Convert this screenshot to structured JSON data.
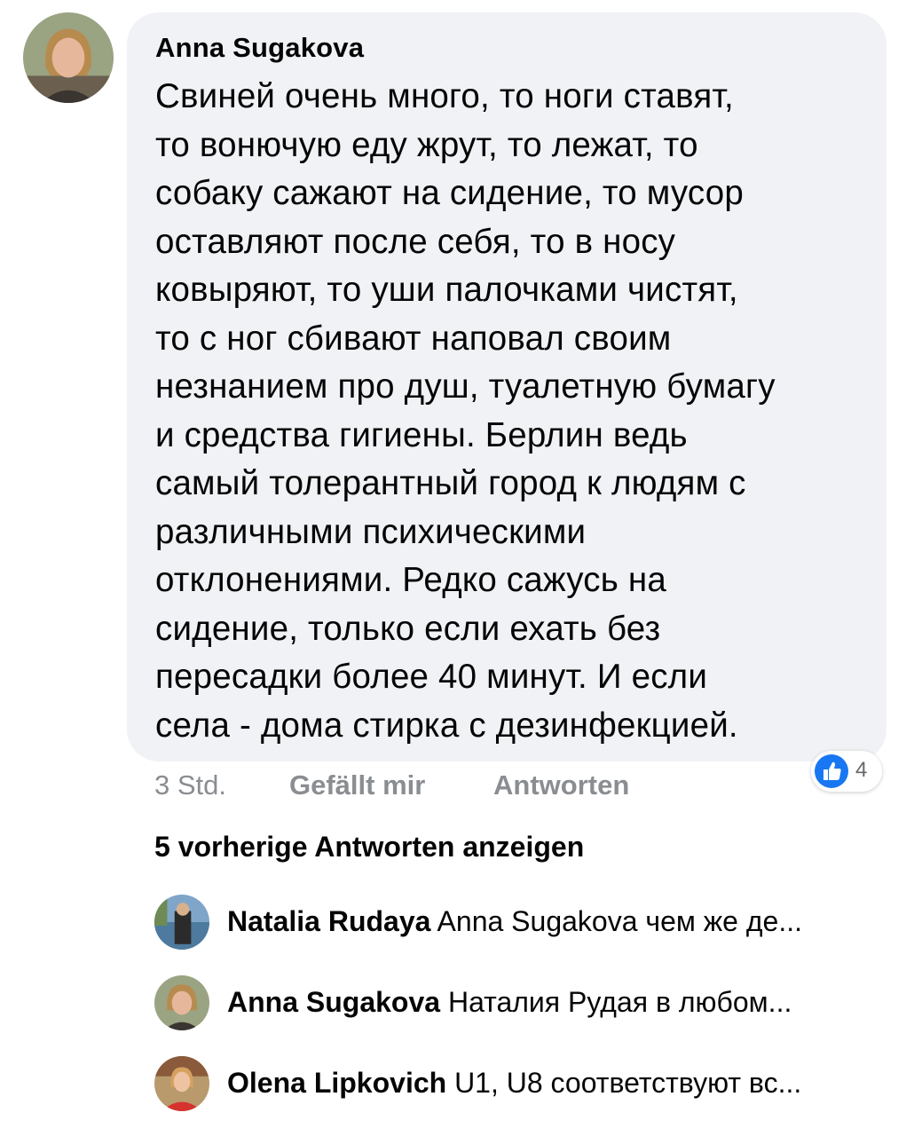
{
  "comment": {
    "author": "Anna Sugakova",
    "lines": [
      "Свиней очень много, то ноги ставят,",
      "то вонючую еду жрут, то лежат, то",
      "собаку сажают на сидение, то мусор",
      "оставляют после себя, то в носу",
      "ковыряют, то уши палочками чистят,",
      "то с ног сбивают наповал своим",
      "незнанием про душ, туалетную бумагу",
      "и средства гигиены. Берлин ведь",
      "самый толерантный город к людям с",
      "различными психическими",
      "отклонениями. Редко сажусь на",
      "сидение, только если ехать без",
      "пересадки более 40 минут. И если",
      "села - дома стирка с дезинфекцией."
    ],
    "time": "3 Std.",
    "like_label": "Gefällt mir",
    "reply_label": "Antworten",
    "reaction_icon": "like-icon",
    "reaction_count": "4"
  },
  "view_previous_label": "5 vorherige Antworten anzeigen",
  "replies": [
    {
      "name": "Natalia Rudaya",
      "text": "Anna Sugakova чем же де..."
    },
    {
      "name": "Anna Sugakova",
      "text": "Наталия Рудая в любом..."
    },
    {
      "name": "Olena Lipkovich",
      "text": "U1, U8 соответствуют вс..."
    }
  ],
  "colors": {
    "bubble": "#f0f2f5",
    "meta_text": "#8a8d91",
    "like_blue": "#1877f2"
  }
}
